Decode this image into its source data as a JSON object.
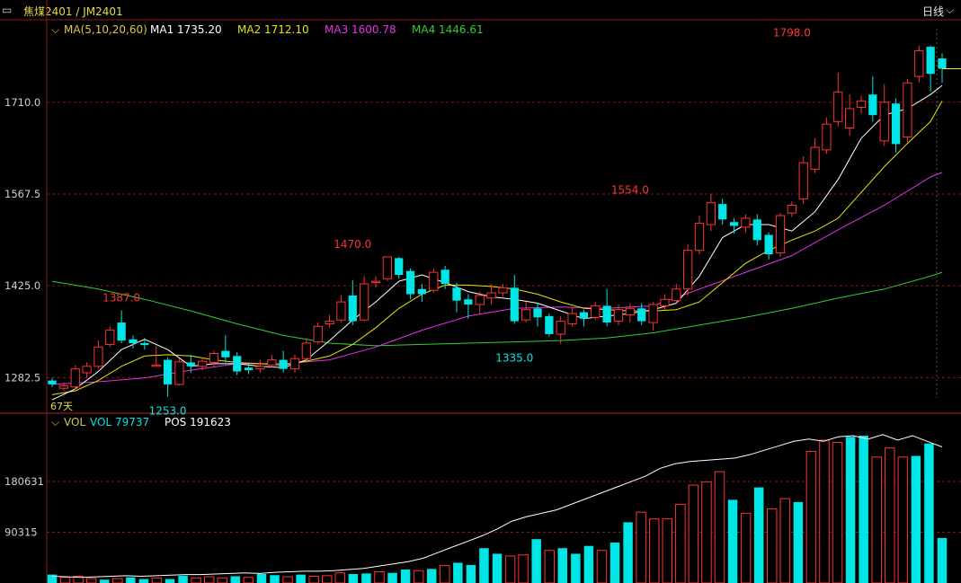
{
  "header": {
    "symbol_icon": "window-menu-icon",
    "title": "焦煤2401 / JM2401",
    "period": "日线",
    "period_icon": "chevron-down-icon"
  },
  "main_legend": {
    "toggle_icon": "chevron-down-icon",
    "label": "MA(5,10,20,60)",
    "ma1": "MA1 1735.20",
    "ma2": "MA2 1712.10",
    "ma3": "MA3 1600.78",
    "ma4": "MA4 1446.61"
  },
  "volume_legend": {
    "toggle_icon": "chevron-down-icon",
    "label": "VOL",
    "vol": "VOL 79737",
    "pos": "POS 191623"
  },
  "days_label": "67天",
  "colors": {
    "up": "#ff3232",
    "down": "#00e5e5",
    "ma1": "#ffffff",
    "ma2": "#e6e600",
    "ma3": "#e632e6",
    "ma4": "#32cd32",
    "pos": "#ffffff",
    "grid": "#7a1a1a",
    "tick": "#d0d0d0",
    "header": "#e8d84a"
  },
  "chart_data": [
    {
      "type": "candlestick",
      "title": "焦煤2401 / JM2401",
      "period": "日线",
      "y_ticks": [
        1282.5,
        1425.0,
        1567.5,
        1710.0
      ],
      "ylim": [
        1230,
        1838
      ],
      "annotations": [
        {
          "text": "1387.0",
          "index": 6,
          "value": 1387.0,
          "kind": "high"
        },
        {
          "text": "1253.0",
          "index": 10,
          "value": 1253.0,
          "kind": "low"
        },
        {
          "text": "1470.0",
          "index": 26,
          "value": 1470.0,
          "kind": "high"
        },
        {
          "text": "1335.0",
          "index": 40,
          "value": 1335.0,
          "kind": "low"
        },
        {
          "text": "1554.0",
          "index": 50,
          "value": 1554.0,
          "kind": "high"
        },
        {
          "text": "1798.0",
          "index": 64,
          "value": 1798.0,
          "kind": "high"
        }
      ],
      "candles": [
        [
          1278,
          1272,
          1282,
          1268
        ],
        [
          1266,
          1270,
          1275,
          1262
        ],
        [
          1268,
          1296,
          1302,
          1264
        ],
        [
          1290,
          1300,
          1306,
          1282
        ],
        [
          1300,
          1330,
          1340,
          1296
        ],
        [
          1334,
          1356,
          1362,
          1330
        ],
        [
          1368,
          1340,
          1387,
          1336
        ],
        [
          1342,
          1336,
          1348,
          1328
        ],
        [
          1336,
          1333,
          1344,
          1326
        ],
        [
          1300,
          1302,
          1332,
          1300
        ],
        [
          1310,
          1272,
          1314,
          1253
        ],
        [
          1272,
          1307,
          1312,
          1270
        ],
        [
          1306,
          1300,
          1318,
          1290
        ],
        [
          1300,
          1308,
          1314,
          1294
        ],
        [
          1306,
          1320,
          1324,
          1300
        ],
        [
          1324,
          1314,
          1348,
          1306
        ],
        [
          1316,
          1292,
          1322,
          1286
        ],
        [
          1298,
          1294,
          1304,
          1288
        ],
        [
          1296,
          1300,
          1310,
          1290
        ],
        [
          1302,
          1310,
          1318,
          1298
        ],
        [
          1310,
          1296,
          1324,
          1290
        ],
        [
          1296,
          1312,
          1318,
          1290
        ],
        [
          1312,
          1336,
          1344,
          1308
        ],
        [
          1338,
          1362,
          1368,
          1334
        ],
        [
          1366,
          1370,
          1380,
          1360
        ],
        [
          1372,
          1400,
          1410,
          1368
        ],
        [
          1410,
          1370,
          1434,
          1364
        ],
        [
          1372,
          1428,
          1440,
          1370
        ],
        [
          1430,
          1432,
          1440,
          1422
        ],
        [
          1436,
          1470,
          1470,
          1432
        ],
        [
          1468,
          1442,
          1470,
          1436
        ],
        [
          1448,
          1412,
          1452,
          1404
        ],
        [
          1420,
          1412,
          1428,
          1400
        ],
        [
          1418,
          1446,
          1452,
          1414
        ],
        [
          1450,
          1428,
          1456,
          1420
        ],
        [
          1422,
          1402,
          1430,
          1384
        ],
        [
          1404,
          1396,
          1412,
          1374
        ],
        [
          1396,
          1410,
          1416,
          1380
        ],
        [
          1406,
          1414,
          1428,
          1396
        ],
        [
          1414,
          1422,
          1428,
          1408
        ],
        [
          1422,
          1370,
          1442,
          1366
        ],
        [
          1372,
          1388,
          1400,
          1368
        ],
        [
          1390,
          1376,
          1398,
          1362
        ],
        [
          1378,
          1350,
          1382,
          1346
        ],
        [
          1350,
          1370,
          1378,
          1335
        ],
        [
          1366,
          1382,
          1392,
          1362
        ],
        [
          1384,
          1374,
          1388,
          1362
        ],
        [
          1376,
          1394,
          1400,
          1372
        ],
        [
          1394,
          1368,
          1420,
          1362
        ],
        [
          1370,
          1388,
          1396,
          1364
        ],
        [
          1380,
          1390,
          1398,
          1368
        ],
        [
          1390,
          1370,
          1398,
          1364
        ],
        [
          1368,
          1396,
          1400,
          1356
        ],
        [
          1394,
          1404,
          1412,
          1388
        ],
        [
          1402,
          1420,
          1428,
          1396
        ],
        [
          1420,
          1480,
          1490,
          1410
        ],
        [
          1480,
          1522,
          1534,
          1474
        ],
        [
          1520,
          1554,
          1568,
          1510
        ],
        [
          1552,
          1528,
          1560,
          1520
        ],
        [
          1524,
          1518,
          1530,
          1506
        ],
        [
          1516,
          1530,
          1536,
          1508
        ],
        [
          1528,
          1496,
          1536,
          1488
        ],
        [
          1504,
          1474,
          1508,
          1466
        ],
        [
          1476,
          1534,
          1538,
          1470
        ],
        [
          1538,
          1550,
          1556,
          1532
        ],
        [
          1560,
          1616,
          1626,
          1552
        ],
        [
          1606,
          1640,
          1654,
          1600
        ],
        [
          1636,
          1676,
          1686,
          1630
        ],
        [
          1680,
          1726,
          1756,
          1672
        ],
        [
          1670,
          1700,
          1722,
          1658
        ],
        [
          1702,
          1712,
          1720,
          1692
        ],
        [
          1722,
          1690,
          1750,
          1680
        ],
        [
          1650,
          1710,
          1738,
          1642
        ],
        [
          1708,
          1645,
          1716,
          1632
        ],
        [
          1656,
          1740,
          1746,
          1648
        ],
        [
          1750,
          1790,
          1798,
          1740
        ],
        [
          1796,
          1754,
          1798,
          1726
        ],
        [
          1778,
          1762,
          1786,
          1740
        ]
      ],
      "ma_series": [
        {
          "name": "MA1",
          "x": [
            0,
            2,
            4,
            6,
            8,
            10,
            12,
            14,
            16,
            18,
            20,
            22,
            24,
            26,
            28,
            30,
            32,
            34,
            36,
            38,
            40,
            42,
            44,
            46,
            48,
            50,
            52,
            54,
            56,
            58,
            60,
            62,
            64,
            66,
            68,
            70,
            72,
            74,
            76,
            77
          ],
          "values": [
            1248,
            1265,
            1292,
            1326,
            1342,
            1326,
            1300,
            1304,
            1304,
            1300,
            1298,
            1310,
            1340,
            1372,
            1400,
            1432,
            1442,
            1430,
            1416,
            1408,
            1404,
            1398,
            1386,
            1374,
            1378,
            1382,
            1388,
            1398,
            1440,
            1500,
            1520,
            1520,
            1510,
            1540,
            1590,
            1654,
            1690,
            1700,
            1722,
            1736
          ]
        },
        {
          "name": "MA2",
          "x": [
            0,
            2,
            4,
            6,
            8,
            10,
            12,
            14,
            16,
            18,
            20,
            22,
            24,
            26,
            28,
            30,
            32,
            34,
            36,
            38,
            40,
            42,
            44,
            46,
            48,
            50,
            52,
            54,
            56,
            58,
            60,
            62,
            64,
            66,
            68,
            70,
            72,
            74,
            76,
            77
          ],
          "values": [
            1256,
            1262,
            1278,
            1300,
            1316,
            1318,
            1316,
            1310,
            1306,
            1304,
            1302,
            1308,
            1316,
            1334,
            1360,
            1390,
            1412,
            1426,
            1426,
            1424,
            1420,
            1412,
            1400,
            1390,
            1388,
            1386,
            1386,
            1388,
            1400,
            1430,
            1460,
            1480,
            1496,
            1510,
            1530,
            1570,
            1610,
            1646,
            1680,
            1712
          ]
        },
        {
          "name": "MA3",
          "x": [
            0,
            4,
            8,
            12,
            16,
            20,
            24,
            28,
            32,
            36,
            40,
            44,
            48,
            52,
            56,
            60,
            64,
            68,
            72,
            76,
            77
          ],
          "values": [
            1272,
            1276,
            1282,
            1294,
            1304,
            1304,
            1310,
            1330,
            1356,
            1378,
            1390,
            1392,
            1390,
            1394,
            1420,
            1446,
            1472,
            1512,
            1550,
            1594,
            1601
          ]
        },
        {
          "name": "MA4",
          "x": [
            0,
            4,
            8,
            12,
            16,
            20,
            24,
            28,
            32,
            36,
            40,
            44,
            48,
            52,
            56,
            60,
            64,
            68,
            72,
            76,
            77
          ],
          "values": [
            1432,
            1420,
            1404,
            1386,
            1366,
            1348,
            1336,
            1332,
            1334,
            1336,
            1338,
            1340,
            1344,
            1352,
            1364,
            1376,
            1390,
            1406,
            1420,
            1440,
            1446
          ]
        }
      ]
    },
    {
      "type": "bar",
      "title": "VOL",
      "y_ticks": [
        90315,
        180631
      ],
      "ylim": [
        0,
        270000
      ],
      "volume": [
        15000,
        10000,
        12000,
        8000,
        6000,
        8000,
        10000,
        7000,
        9000,
        7000,
        13000,
        9000,
        11000,
        9000,
        12000,
        10000,
        16000,
        14000,
        11000,
        15000,
        12000,
        13000,
        18000,
        16000,
        17000,
        20000,
        18000,
        24000,
        22000,
        25000,
        31000,
        36000,
        32000,
        62000,
        52000,
        48000,
        50000,
        78000,
        58000,
        62000,
        52000,
        66000,
        58000,
        72000,
        108000,
        126000,
        114000,
        114000,
        140000,
        174000,
        180000,
        198000,
        148000,
        124000,
        170000,
        132000,
        150000,
        144000,
        234000,
        254000,
        250000,
        260000,
        262000,
        224000,
        240000,
        224000,
        226000,
        248000,
        80000
      ],
      "volume_up": [
        false,
        true,
        true,
        true,
        false,
        true,
        false,
        false,
        true,
        false,
        false,
        true,
        true,
        true,
        false,
        true,
        false,
        false,
        true,
        false,
        true,
        true,
        true,
        false,
        false,
        true,
        false,
        false,
        true,
        false,
        true,
        false,
        false,
        false,
        false,
        true,
        true,
        false,
        true,
        false,
        false,
        false,
        true,
        false,
        false,
        true,
        true,
        true,
        true,
        true,
        true,
        true,
        false,
        true,
        false,
        true,
        true,
        false,
        true,
        true,
        true,
        false,
        false,
        true,
        true,
        true,
        false,
        false,
        false
      ],
      "pos": [
        12000,
        11000,
        10000,
        11000,
        12000,
        13000,
        12000,
        13000,
        14000,
        15000,
        15000,
        16000,
        17000,
        18000,
        17000,
        19000,
        20000,
        21000,
        21000,
        22000,
        24000,
        26000,
        30000,
        34000,
        38000,
        44000,
        54000,
        64000,
        74000,
        84000,
        96000,
        110000,
        118000,
        124000,
        130000,
        140000,
        150000,
        160000,
        170000,
        180000,
        190000,
        204000,
        212000,
        216000,
        218000,
        220000,
        222000,
        228000,
        236000,
        244000,
        252000,
        256000,
        252000,
        260000,
        262000,
        256000,
        264000,
        254000,
        262000,
        252000,
        242000
      ]
    }
  ]
}
